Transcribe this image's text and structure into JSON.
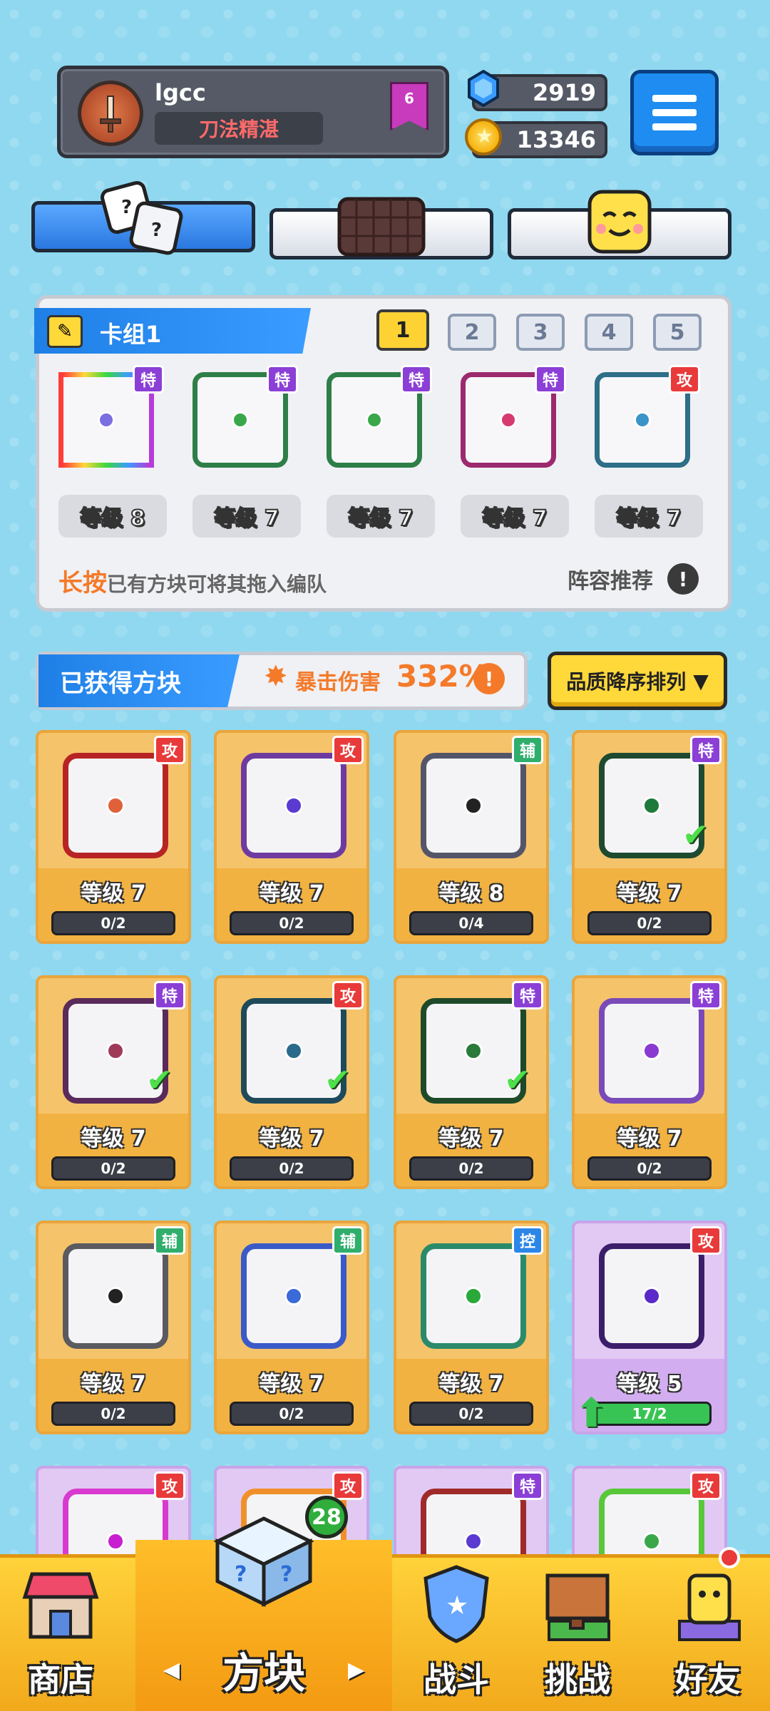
{
  "profile": {
    "username": "lgcc",
    "title": "刀法精湛",
    "rank": "6"
  },
  "currency": {
    "gems": "2919",
    "coins": "13346"
  },
  "deck": {
    "name": "卡组1",
    "numbers": [
      "1",
      "2",
      "3",
      "4",
      "5"
    ],
    "active_index": 0,
    "slots": [
      {
        "level": "等级 8",
        "tag": "特",
        "tag_color": "purple",
        "frame": "#ffffff",
        "dot": "#7a6ee0"
      },
      {
        "level": "等级 7",
        "tag": "特",
        "tag_color": "purple",
        "frame": "#2e7e48",
        "dot": "#3aa84a"
      },
      {
        "level": "等级 7",
        "tag": "特",
        "tag_color": "purple",
        "frame": "#2e7e48",
        "dot": "#3aa84a"
      },
      {
        "level": "等级 7",
        "tag": "特",
        "tag_color": "purple",
        "frame": "#9c2a6e",
        "dot": "#d63a6e"
      },
      {
        "level": "等级 7",
        "tag": "攻",
        "tag_color": "red",
        "frame": "#2e6e88",
        "dot": "#3a94c8"
      }
    ],
    "hint_bold": "长按",
    "hint_text": "已有方块可将其拖入编队",
    "recommend": "阵容推荐",
    "info": "!"
  },
  "owned": {
    "title": "已获得方块",
    "crit_label": "暴击伤害",
    "crit_value": "332%",
    "crit_info": "!",
    "sort_label": "品质降序排列",
    "sort_arrow": "▼"
  },
  "cards": [
    {
      "level": "等级 7",
      "progress": "0/2",
      "progress_pct": 0,
      "tag": "攻",
      "tag_color": "red",
      "frame": "#b82424",
      "dot": "#e0603a",
      "check": false,
      "bg": "gold"
    },
    {
      "level": "等级 7",
      "progress": "0/2",
      "progress_pct": 0,
      "tag": "攻",
      "tag_color": "red",
      "frame": "#6e3aa0",
      "dot": "#5a3ad0",
      "check": false,
      "bg": "gold"
    },
    {
      "level": "等级 8",
      "progress": "0/4",
      "progress_pct": 0,
      "tag": "辅",
      "tag_color": "green",
      "frame": "#55556a",
      "dot": "#222222",
      "check": false,
      "bg": "gold"
    },
    {
      "level": "等级 7",
      "progress": "0/2",
      "progress_pct": 0,
      "tag": "特",
      "tag_color": "purple",
      "frame": "#1e4a30",
      "dot": "#1e7a3a",
      "check": true,
      "bg": "gold"
    },
    {
      "level": "等级 7",
      "progress": "0/2",
      "progress_pct": 0,
      "tag": "特",
      "tag_color": "purple",
      "frame": "#5a2a5a",
      "dot": "#a03a5a",
      "check": true,
      "bg": "gold"
    },
    {
      "level": "等级 7",
      "progress": "0/2",
      "progress_pct": 0,
      "tag": "攻",
      "tag_color": "red",
      "frame": "#1e4a5a",
      "dot": "#2a6a8a",
      "check": true,
      "bg": "gold"
    },
    {
      "level": "等级 7",
      "progress": "0/2",
      "progress_pct": 0,
      "tag": "特",
      "tag_color": "purple",
      "frame": "#1e4a2a",
      "dot": "#2a7a3a",
      "check": true,
      "bg": "gold"
    },
    {
      "level": "等级 7",
      "progress": "0/2",
      "progress_pct": 0,
      "tag": "特",
      "tag_color": "purple",
      "frame": "#7a4ab8",
      "dot": "#8a3ad0",
      "check": false,
      "bg": "gold"
    },
    {
      "level": "等级 7",
      "progress": "0/2",
      "progress_pct": 0,
      "tag": "辅",
      "tag_color": "green",
      "frame": "#5a5a60",
      "dot": "#222222",
      "check": false,
      "bg": "gold"
    },
    {
      "level": "等级 7",
      "progress": "0/2",
      "progress_pct": 0,
      "tag": "辅",
      "tag_color": "green",
      "frame": "#3a5ac8",
      "dot": "#3a6ad8",
      "check": false,
      "bg": "gold"
    },
    {
      "level": "等级 7",
      "progress": "0/2",
      "progress_pct": 0,
      "tag": "控",
      "tag_color": "blue",
      "frame": "#2a8a6a",
      "dot": "#2aa83a",
      "check": false,
      "bg": "gold"
    },
    {
      "level": "等级 5",
      "progress": "17/2",
      "progress_pct": 100,
      "tag": "攻",
      "tag_color": "red",
      "frame": "#3a1e6a",
      "dot": "#5a2ac8",
      "check": false,
      "bg": "purple",
      "upgrade": true
    },
    {
      "level": "",
      "progress": "",
      "progress_pct": 0,
      "tag": "攻",
      "tag_color": "red",
      "frame": "#d83ad0",
      "dot": "#c81ed0",
      "check": false,
      "bg": "purple"
    },
    {
      "level": "",
      "progress": "",
      "progress_pct": 0,
      "tag": "攻",
      "tag_color": "red",
      "frame": "#f0902a",
      "dot": "#f0902a",
      "check": false,
      "bg": "purple"
    },
    {
      "level": "",
      "progress": "",
      "progress_pct": 0,
      "tag": "特",
      "tag_color": "purple",
      "frame": "#a02a2a",
      "dot": "#5a3ad0",
      "check": false,
      "bg": "purple"
    },
    {
      "level": "",
      "progress": "",
      "progress_pct": 0,
      "tag": "攻",
      "tag_color": "red",
      "frame": "#58c83a",
      "dot": "#3aa84a",
      "check": false,
      "bg": "purple"
    }
  ],
  "nav": {
    "shop": "商店",
    "blocks": "方块",
    "battle": "战斗",
    "challenge": "挑战",
    "friends": "好友",
    "blocks_badge": "28",
    "left_arrow": "◀",
    "right_arrow": "▶"
  },
  "colors": {
    "accent_blue": "#1e8cf0",
    "gold": "#ffd83a",
    "orange": "#f47a2a"
  }
}
